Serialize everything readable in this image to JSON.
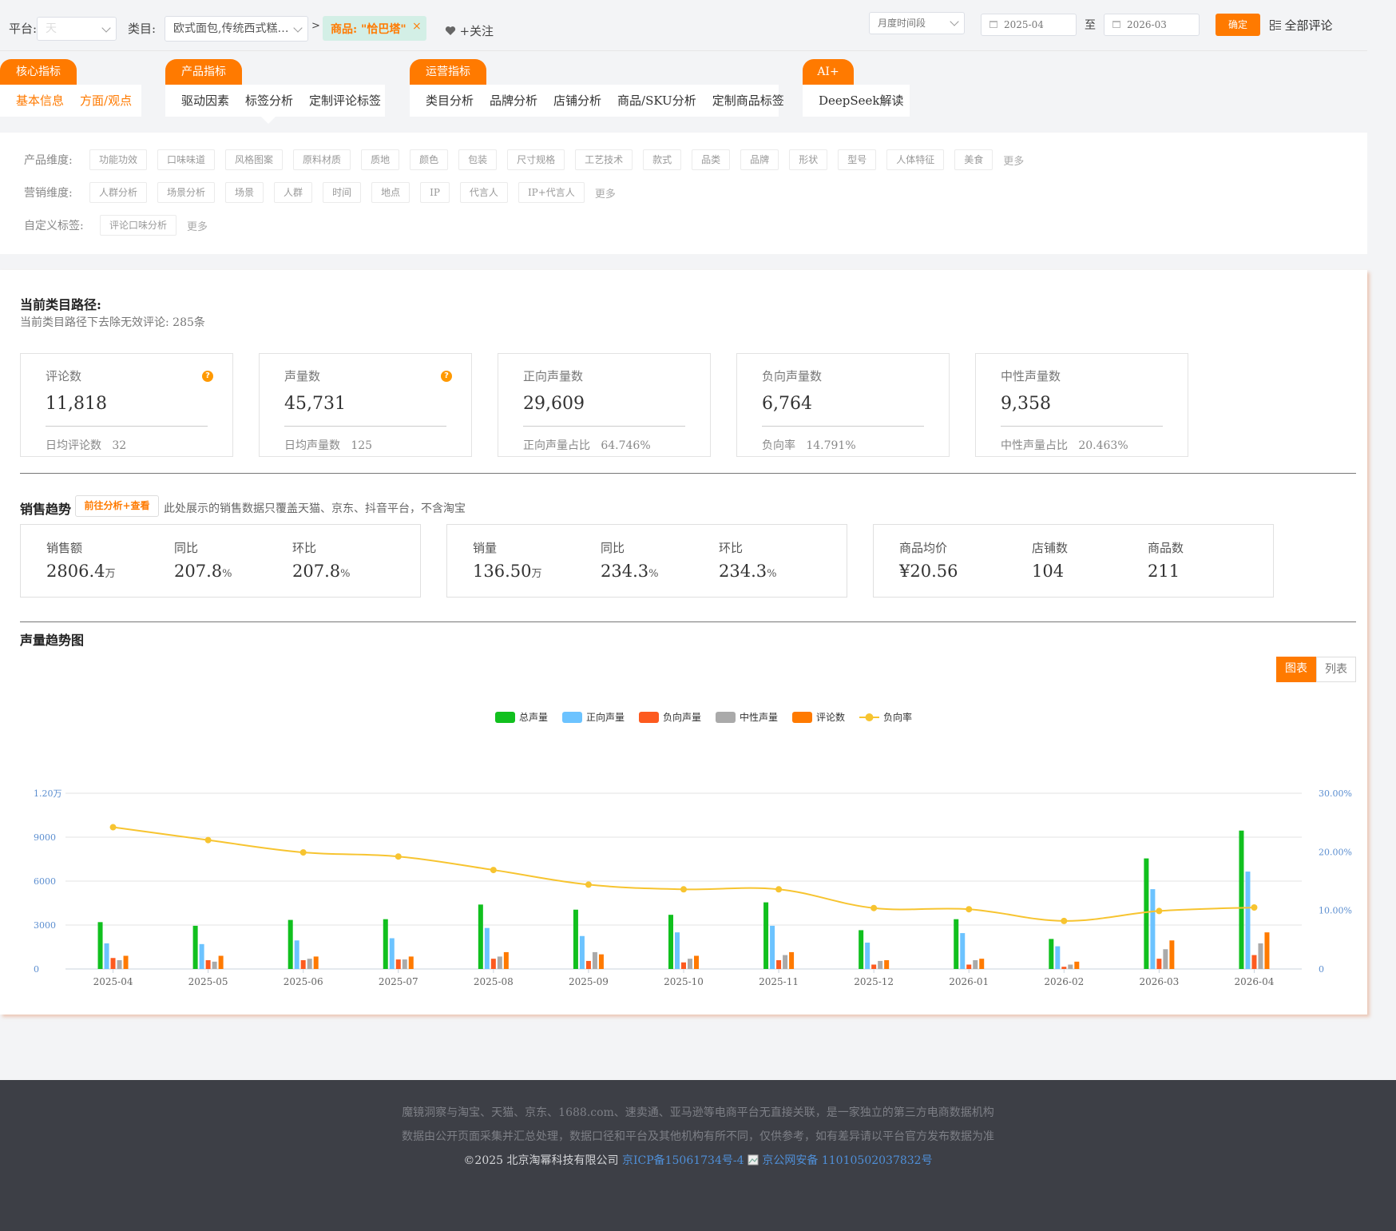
{
  "topbar": {
    "platform_label": "平台:",
    "platform_value": "天",
    "category_label": "类目:",
    "category_value": "欧式面包,传统西式糕…",
    "separator": ">",
    "product_tag": "商品: \"恰巴塔\"",
    "product_tag_close": "×",
    "follow_label": "+关注",
    "period_select": "月度时间段",
    "date_from": "2025-04",
    "date_to_sep": "至",
    "date_to": "2026-03",
    "confirm_label": "确定",
    "all_reviews_label": "全部评论"
  },
  "tab_groups": [
    {
      "title": "核心指标",
      "items": [
        "基本信息",
        "方面/观点"
      ]
    },
    {
      "title": "产品指标",
      "items": [
        "驱动因素",
        "标签分析",
        "定制评论标签"
      ]
    },
    {
      "title": "运营指标",
      "items": [
        "类目分析",
        "品牌分析",
        "店铺分析",
        "商品/SKU分析",
        "定制商品标签"
      ]
    },
    {
      "title": "AI+",
      "items": [
        "DeepSeek解读"
      ]
    }
  ],
  "dimensions": {
    "product": {
      "label": "产品维度:",
      "chips": [
        "功能功效",
        "口味味道",
        "风格图案",
        "原料材质",
        "质地",
        "颜色",
        "包装",
        "尺寸规格",
        "工艺技术",
        "款式",
        "品类",
        "品牌",
        "形状",
        "型号",
        "人体特征",
        "美食"
      ],
      "more": "更多"
    },
    "marketing": {
      "label": "营销维度:",
      "chips": [
        "人群分析",
        "场景分析",
        "场景",
        "人群",
        "时间",
        "地点",
        "IP",
        "代言人",
        "IP+代言人"
      ],
      "more": "更多"
    },
    "custom": {
      "label": "自定义标签:",
      "chips": [
        "评论口味分析"
      ],
      "more": "更多"
    }
  },
  "path": {
    "title": "当前类目路径:",
    "subtitle": "当前类目路径下去除无效评论: 285条"
  },
  "stats": [
    {
      "title": "评论数",
      "value": "11,818",
      "sub": "日均评论数   32",
      "help": "?"
    },
    {
      "title": "声量数",
      "value": "45,731",
      "sub": "日均声量数   125",
      "help": "?"
    },
    {
      "title": "正向声量数",
      "value": "29,609",
      "sub": "正向声量占比   64.746%"
    },
    {
      "title": "负向声量数",
      "value": "6,764",
      "sub": "负向率   14.791%"
    },
    {
      "title": "中性声量数",
      "value": "9,358",
      "sub": "中性声量占比   20.463%"
    }
  ],
  "sales": {
    "title": "销售趋势",
    "button": "前往分析+查看",
    "note": "此处展示的销售数据只覆盖天猫、京东、抖音平台，不含淘宝",
    "boxes": [
      [
        {
          "label": "销售额",
          "value": "2806.4",
          "unit": "万"
        },
        {
          "label": "同比",
          "value": "207.8",
          "unit": "%"
        },
        {
          "label": "环比",
          "value": "207.8",
          "unit": "%"
        }
      ],
      [
        {
          "label": "销量",
          "value": "136.50",
          "unit": "万"
        },
        {
          "label": "同比",
          "value": "234.3",
          "unit": "%"
        },
        {
          "label": "环比",
          "value": "234.3",
          "unit": "%"
        }
      ],
      [
        {
          "label": "商品均价",
          "value": "¥20.56",
          "unit": ""
        },
        {
          "label": "店铺数",
          "value": "104",
          "unit": ""
        },
        {
          "label": "商品数",
          "value": "211",
          "unit": ""
        }
      ]
    ]
  },
  "volume_chart": {
    "title": "声量趋势图",
    "view_chart": "图表",
    "view_list": "列表"
  },
  "chart_data": {
    "type": "bar",
    "categories": [
      "2025-04",
      "2025-05",
      "2025-06",
      "2025-07",
      "2025-08",
      "2025-09",
      "2025-10",
      "2025-11",
      "2025-12",
      "2026-01",
      "2026-02",
      "2026-03",
      "2026-04"
    ],
    "series": [
      {
        "name": "总声量",
        "type": "bar",
        "color": "#11c01e",
        "values": [
          3200,
          2950,
          3350,
          3400,
          4400,
          4050,
          3700,
          4550,
          2650,
          3400,
          2050,
          7550,
          9450
        ]
      },
      {
        "name": "正向声量",
        "type": "bar",
        "color": "#6cc3ff",
        "values": [
          1750,
          1700,
          1950,
          2100,
          2800,
          2250,
          2500,
          2950,
          1800,
          2450,
          1550,
          5450,
          6650
        ]
      },
      {
        "name": "负向声量",
        "type": "bar",
        "color": "#fd5a1f",
        "values": [
          750,
          600,
          600,
          650,
          700,
          550,
          450,
          600,
          300,
          300,
          150,
          700,
          950
        ]
      },
      {
        "name": "中性声量",
        "type": "bar",
        "color": "#aaaaaa",
        "values": [
          600,
          500,
          700,
          650,
          850,
          1150,
          700,
          950,
          550,
          600,
          300,
          1350,
          1750
        ]
      },
      {
        "name": "评论数",
        "type": "bar",
        "color": "#ff7a00",
        "values": [
          900,
          900,
          850,
          850,
          1150,
          1000,
          900,
          1150,
          600,
          700,
          500,
          1950,
          2500
        ]
      },
      {
        "name": "负向率",
        "type": "line",
        "axis": "right",
        "color": "#f7c430",
        "values": [
          24.2,
          22.0,
          19.9,
          19.2,
          16.9,
          14.4,
          13.6,
          13.6,
          10.4,
          10.2,
          8.2,
          9.9,
          10.5
        ]
      }
    ],
    "left_axis": {
      "ticks": [
        "0",
        "3000",
        "6000",
        "9000",
        "1.20万"
      ],
      "values": [
        0,
        3000,
        6000,
        9000,
        12000
      ],
      "ylim": [
        0,
        12000
      ]
    },
    "right_axis": {
      "ticks": [
        "0",
        "10.00%",
        "20.00%",
        "30.00%"
      ],
      "values": [
        0,
        10,
        20,
        30
      ],
      "ylim": [
        0,
        30
      ]
    },
    "legend_position": "top-center",
    "grid": true
  },
  "footer": {
    "line1": "魔镜洞察与淘宝、天猫、京东、1688.com、速卖通、亚马逊等电商平台无直接关联，是一家独立的第三方电商数据机构",
    "line2": "数据由公开页面采集并汇总处理，数据口径和平台及其他机构有所不同，仅供参考，如有差异请以平台官方发布数据为准",
    "copyright": "©2025 北京淘幂科技有限公司",
    "icp": "京ICP备15061734号-4",
    "police": "京公网安备 11010502037832号"
  },
  "colors": {
    "accent": "#ff7a00",
    "link": "#3b86d6",
    "footer_bg": "#3d3f46"
  }
}
